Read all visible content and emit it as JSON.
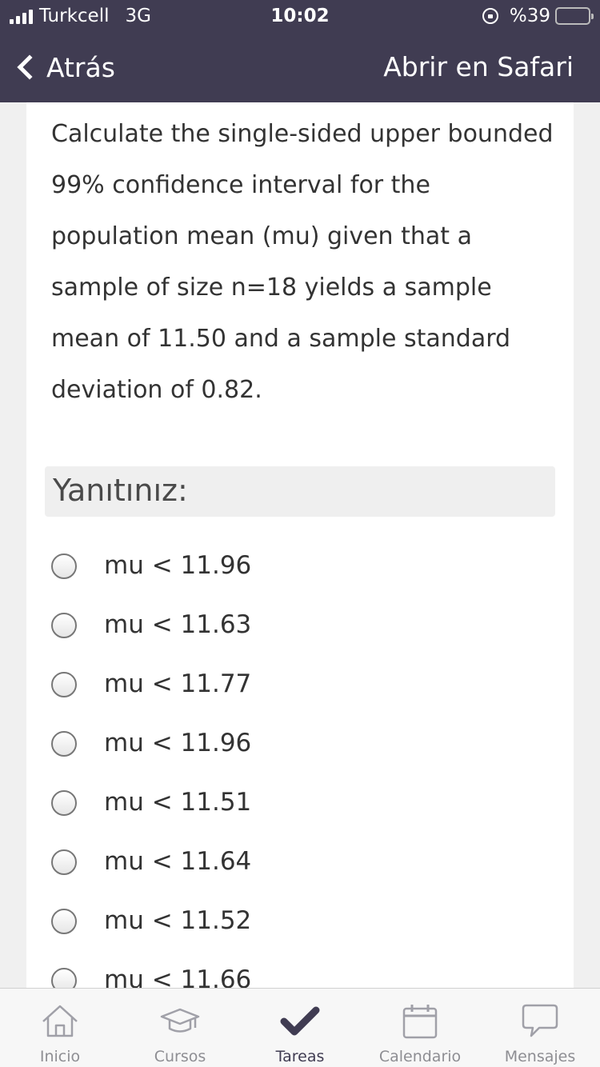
{
  "status_bar": {
    "carrier": "Turkcell",
    "network": "3G",
    "time": "10:02",
    "battery": "%39",
    "battery_level": 0.39,
    "battery_color": "#f2c500"
  },
  "nav": {
    "back_label": "Atrás",
    "open_in_safari": "Abrir en Safari",
    "bar_color": "#403c52"
  },
  "question": {
    "text": "Calculate the single-sided upper bounded 99% confidence interval for the population mean (mu) given that a sample of size n=18 yields a sample mean of 11.50 and a sample standard deviation of 0.82."
  },
  "answer_section": {
    "heading": "Yanıtınız:"
  },
  "options": [
    {
      "label": "mu < 11.96"
    },
    {
      "label": "mu < 11.63"
    },
    {
      "label": "mu < 11.77"
    },
    {
      "label": "mu < 11.96"
    },
    {
      "label": "mu < 11.51"
    },
    {
      "label": "mu < 11.64"
    },
    {
      "label": "mu < 11.52"
    },
    {
      "label": "mu < 11.66"
    }
  ],
  "tab_bar": {
    "tabs": [
      {
        "label": "Inicio",
        "icon": "home-icon"
      },
      {
        "label": "Cursos",
        "icon": "graduation-cap-icon"
      },
      {
        "label": "Tareas",
        "icon": "checkmark-icon",
        "active": true
      },
      {
        "label": "Calendario",
        "icon": "calendar-icon"
      },
      {
        "label": "Mensajes",
        "icon": "chat-bubble-icon"
      }
    ]
  }
}
